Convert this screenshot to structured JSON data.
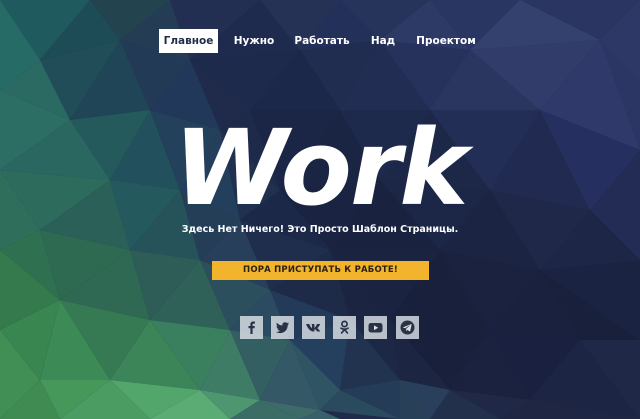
{
  "nav": {
    "items": [
      {
        "label": "Главное",
        "active": true
      },
      {
        "label": "Нужно",
        "active": false
      },
      {
        "label": "Работать",
        "active": false
      },
      {
        "label": "Над",
        "active": false
      },
      {
        "label": "Проектом",
        "active": false
      }
    ]
  },
  "hero": {
    "title": "Work",
    "subtitle": "Здесь Нет Ничего! Это Просто Шаблон Страницы.",
    "cta_label": "ПОРА ПРИСТУПАТЬ К РАБОТЕ!"
  },
  "social": {
    "icons": [
      "facebook-icon",
      "twitter-icon",
      "vk-icon",
      "odnoklassniki-icon",
      "youtube-icon",
      "telegram-icon"
    ]
  },
  "colors": {
    "accent": "#f2b42d",
    "background": "#1e2a4a",
    "nav_active_bg": "#ffffff"
  }
}
